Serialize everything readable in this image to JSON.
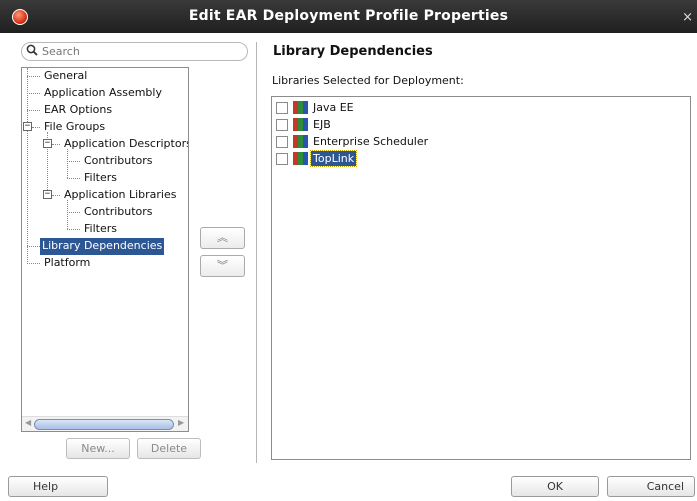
{
  "window": {
    "title": "Edit EAR Deployment Profile Properties",
    "close_glyph": "×"
  },
  "search": {
    "placeholder": "Search",
    "icon": "magnifier-icon"
  },
  "tree": {
    "items": [
      {
        "label": "General"
      },
      {
        "label": "Application Assembly"
      },
      {
        "label": "EAR Options"
      },
      {
        "label": "File Groups",
        "expanded": true
      },
      {
        "label": "Application Descriptors",
        "expanded": true
      },
      {
        "label": "Contributors"
      },
      {
        "label": "Filters"
      },
      {
        "label": "Application Libraries",
        "expanded": true
      },
      {
        "label": "Contributors"
      },
      {
        "label": "Filters"
      },
      {
        "label": "Library Dependencies",
        "selected": true
      },
      {
        "label": "Platform"
      }
    ],
    "new_button": "New...",
    "delete_button": "Delete"
  },
  "move": {
    "up_glyph": "︽",
    "down_glyph": "︾"
  },
  "panel": {
    "heading": "Library Dependencies",
    "list_label": "Libraries Selected for Deployment:",
    "libraries": [
      {
        "label": "Java EE",
        "checked": false,
        "selected": false
      },
      {
        "label": "EJB",
        "checked": false,
        "selected": false
      },
      {
        "label": "Enterprise Scheduler",
        "checked": false,
        "selected": false
      },
      {
        "label": "TopLink",
        "checked": false,
        "selected": true
      }
    ]
  },
  "footer": {
    "help": "Help",
    "ok": "OK",
    "cancel": "Cancel"
  },
  "colors": {
    "selection": "#2d5794",
    "titlebar": "#2a2a2a"
  }
}
